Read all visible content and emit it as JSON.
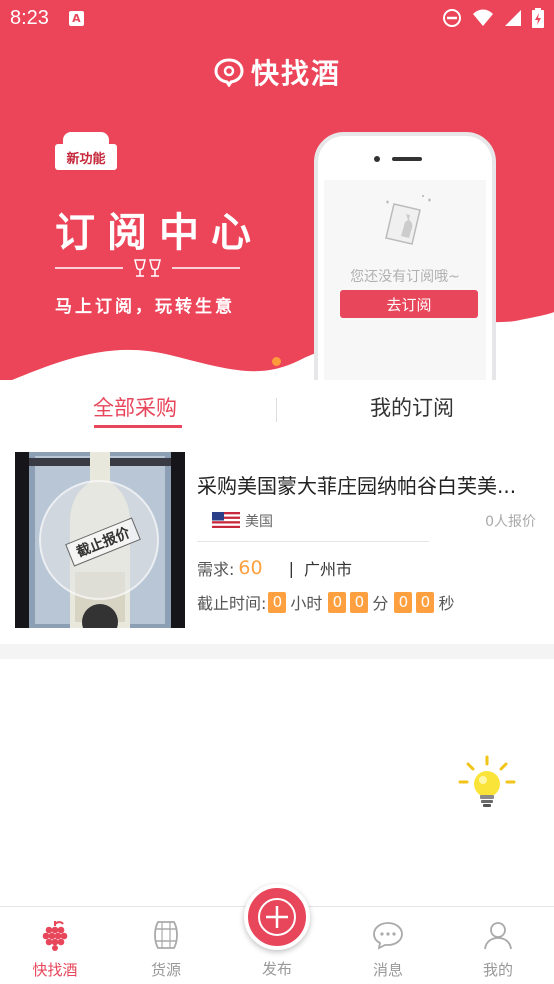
{
  "status_bar": {
    "time": "8:23",
    "notification_icon": "A"
  },
  "hero": {
    "app_name": "快找酒",
    "badge": "新功能",
    "title": "订阅中心",
    "subtitle": "马上订阅，玩转生意",
    "phone_empty_text": "您还没有订阅哦~",
    "phone_button": "去订阅"
  },
  "tabs": {
    "all": "全部采购",
    "mine": "我的订阅"
  },
  "listing": {
    "title": "采购美国蒙大菲庄园纳帕谷白芙美...",
    "stamp": "截止报价",
    "country": "美国",
    "quote_count": "0人报价",
    "demand_label": "需求:",
    "demand_value": "60",
    "separator": "|",
    "city": "广州市",
    "deadline_label": "截止时间:",
    "hours": [
      "0"
    ],
    "hours_unit": "小时",
    "minutes": [
      "0",
      "0"
    ],
    "minutes_unit": "分",
    "seconds": [
      "0",
      "0"
    ],
    "seconds_unit": "秒"
  },
  "nav": {
    "home": "快找酒",
    "supply": "货源",
    "publish": "发布",
    "messages": "消息",
    "profile": "我的"
  },
  "colors": {
    "brand": "#e8465a",
    "accent": "#ffa040"
  }
}
